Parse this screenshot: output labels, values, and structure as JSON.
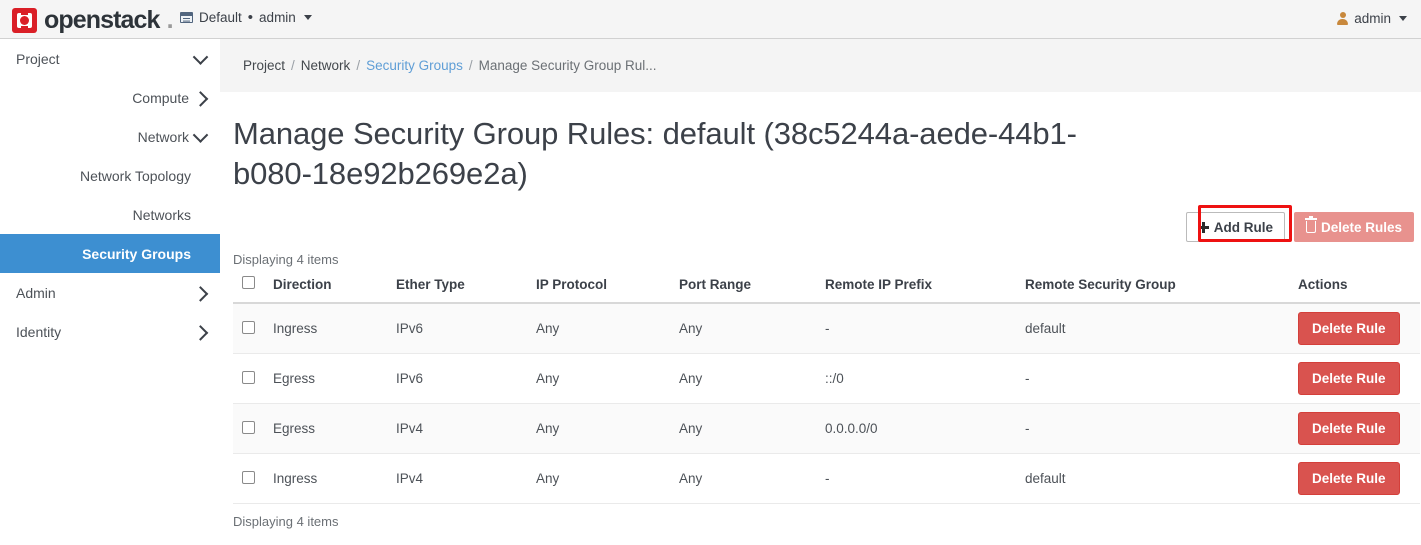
{
  "topbar": {
    "brand": "openstack",
    "brand_dot": ".",
    "context_label": "Default",
    "context_separator": "•",
    "context_user": "admin",
    "context_icon": "window-icon",
    "user_name": "admin",
    "user_icon": "user-icon"
  },
  "sidebar": {
    "items": [
      {
        "label": "Project",
        "level": 0,
        "chevron": "down",
        "active": false
      },
      {
        "label": "Compute",
        "level": 1,
        "chevron": "right",
        "active": false
      },
      {
        "label": "Network",
        "level": 1,
        "chevron": "down",
        "active": false
      },
      {
        "label": "Network Topology",
        "level": 2,
        "chevron": "none",
        "active": false
      },
      {
        "label": "Networks",
        "level": 2,
        "chevron": "none",
        "active": false
      },
      {
        "label": "Security Groups",
        "level": 2,
        "chevron": "none",
        "active": true
      },
      {
        "label": "Admin",
        "level": 0,
        "chevron": "right",
        "active": false
      },
      {
        "label": "Identity",
        "level": 0,
        "chevron": "right",
        "active": false
      }
    ]
  },
  "breadcrumb": {
    "items": [
      {
        "label": "Project",
        "type": "text"
      },
      {
        "label": "Network",
        "type": "text"
      },
      {
        "label": "Security Groups",
        "type": "link"
      },
      {
        "label": "Manage Security Group Rul...",
        "type": "current"
      }
    ],
    "separator": "/"
  },
  "page": {
    "title": "Manage Security Group Rules: default (38c5244a-aede-44b1-b080-18e92b269e2a)",
    "count_top": "Displaying 4 items",
    "count_bottom": "Displaying 4 items"
  },
  "toolbar": {
    "add_rule_label": "Add Rule",
    "add_rule_icon": "plus-icon",
    "delete_rules_label": "Delete Rules",
    "delete_rules_icon": "trash-icon",
    "highlight_color": "#ee1111",
    "delete_rules_color": "#e8928e"
  },
  "table": {
    "headers": [
      "Direction",
      "Ether Type",
      "IP Protocol",
      "Port Range",
      "Remote IP Prefix",
      "Remote Security Group",
      "Actions"
    ],
    "row_action_label": "Delete Rule",
    "row_action_color": "#d9534f",
    "rows": [
      {
        "direction": "Ingress",
        "ether_type": "IPv6",
        "ip_protocol": "Any",
        "port_range": "Any",
        "remote_ip_prefix": "-",
        "remote_security_group": "default"
      },
      {
        "direction": "Egress",
        "ether_type": "IPv6",
        "ip_protocol": "Any",
        "port_range": "Any",
        "remote_ip_prefix": "::/0",
        "remote_security_group": "-"
      },
      {
        "direction": "Egress",
        "ether_type": "IPv4",
        "ip_protocol": "Any",
        "port_range": "Any",
        "remote_ip_prefix": "0.0.0.0/0",
        "remote_security_group": "-"
      },
      {
        "direction": "Ingress",
        "ether_type": "IPv4",
        "ip_protocol": "Any",
        "port_range": "Any",
        "remote_ip_prefix": "-",
        "remote_security_group": "default"
      }
    ]
  },
  "colors": {
    "brand_red": "#da1f27",
    "active_nav_blue": "#3d8fd1",
    "link_blue": "#5f9ed6"
  }
}
